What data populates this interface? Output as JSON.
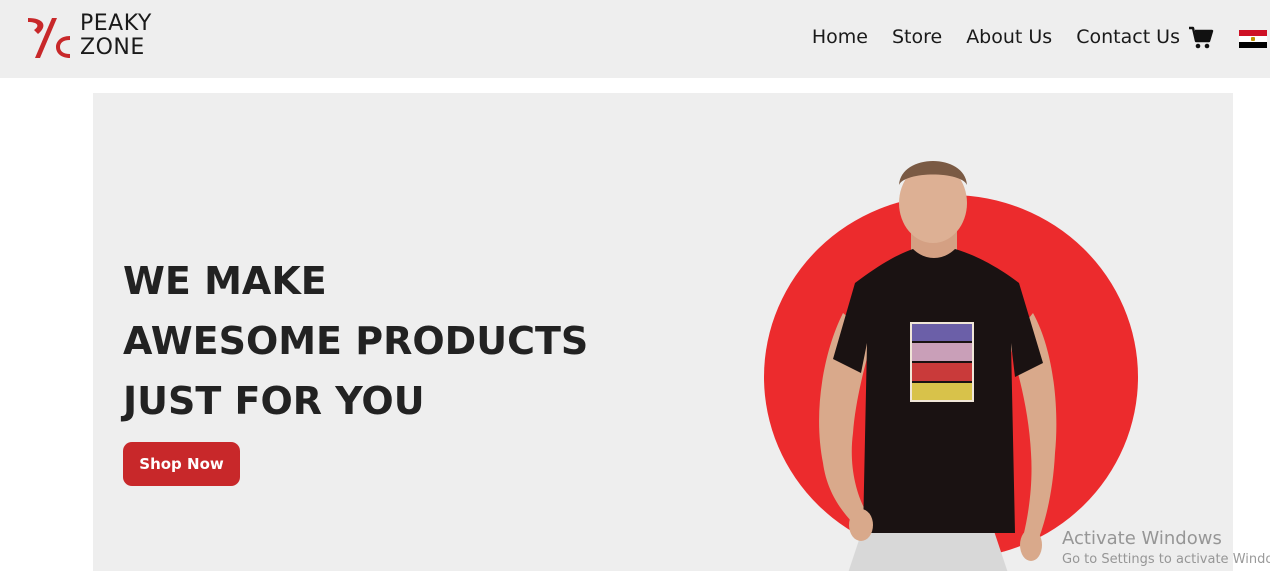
{
  "brand": {
    "name_line1": "PEAKY",
    "name_line2": "ZONE"
  },
  "nav": {
    "links": [
      "Home",
      "Store",
      "About Us",
      "Contact Us"
    ]
  },
  "hero": {
    "title_lines": [
      "WE MAKE",
      "AWESOME PRODUCTS",
      "JUST FOR YOU"
    ],
    "cta_label": "Shop Now"
  },
  "icons": {
    "cart": "shopping-cart-icon",
    "language": "egypt-flag-icon"
  },
  "colors": {
    "accent_red": "#ec2b2d",
    "button_red": "#c8282a",
    "nav_bg": "#eeeeee",
    "hero_bg": "#eeeeee",
    "text_dark": "#222222"
  },
  "watermark": {
    "title": "Activate Windows",
    "subtitle": "Go to Settings to activate Windows."
  }
}
